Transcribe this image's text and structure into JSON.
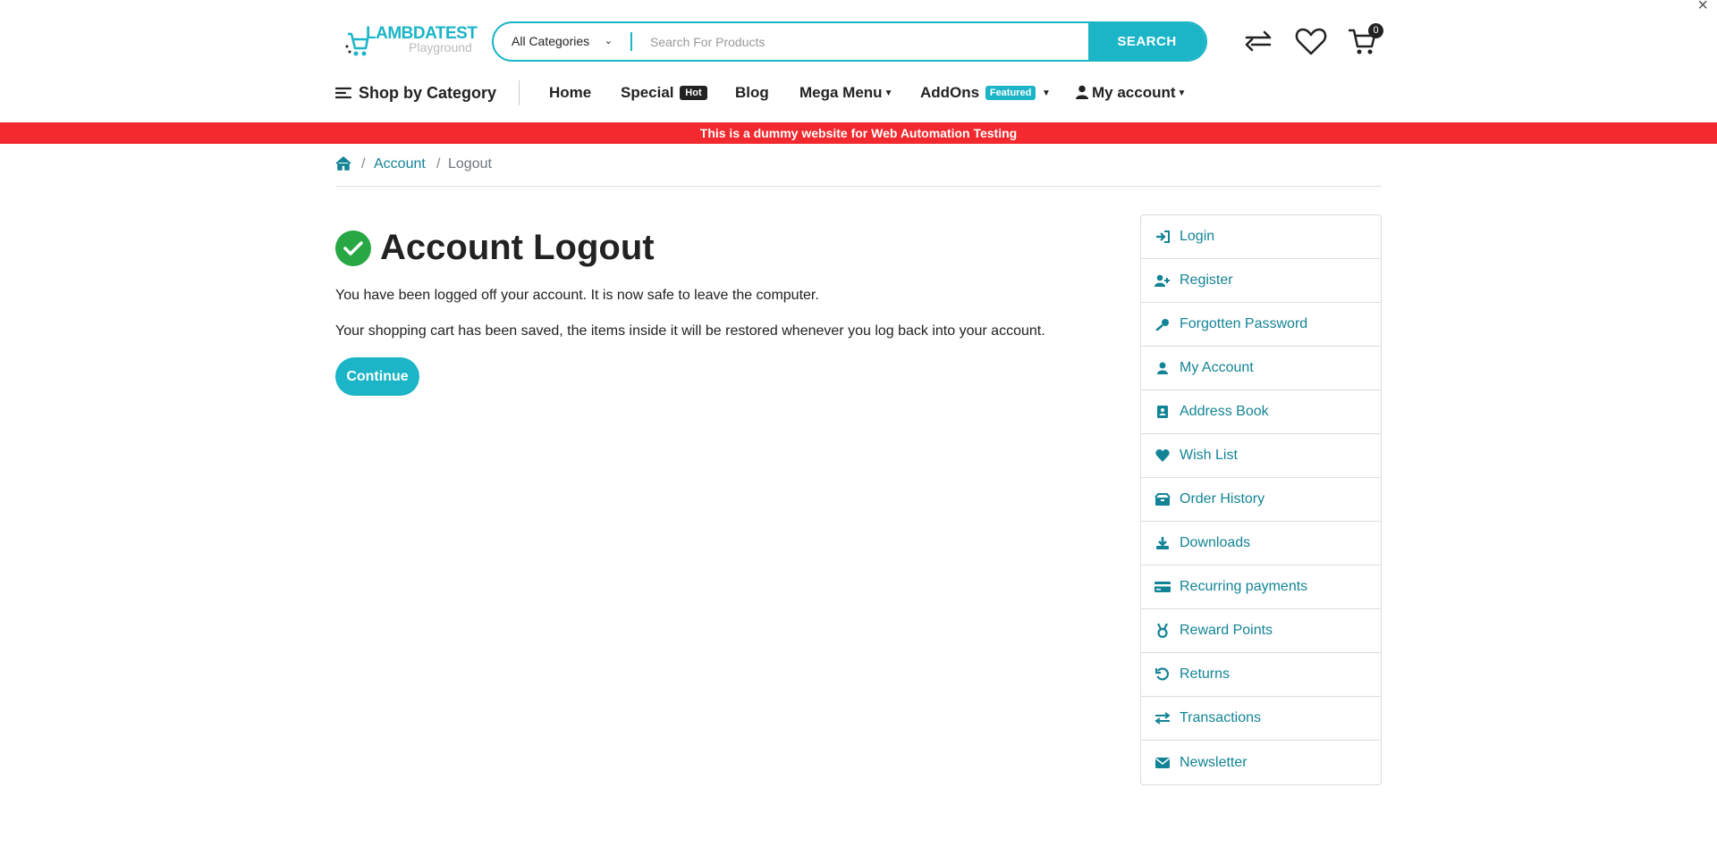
{
  "header": {
    "logo_brand": "LAMBDATEST",
    "logo_sub": "Playground",
    "category_select": "All Categories",
    "search_placeholder": "Search For Products",
    "search_button": "SEARCH",
    "cart_count": "0"
  },
  "nav": {
    "shop_by_category": "Shop by Category",
    "home": "Home",
    "special": "Special",
    "special_badge": "Hot",
    "blog": "Blog",
    "mega_menu": "Mega Menu",
    "addons": "AddOns",
    "addons_badge": "Featured",
    "my_account": "My account"
  },
  "banner": "This is a dummy website for Web Automation Testing",
  "breadcrumb": {
    "account": "Account",
    "current": "Logout",
    "separator": "/"
  },
  "main": {
    "title": "Account Logout",
    "message_1": "You have been logged off your account. It is now safe to leave the computer.",
    "message_2": "Your shopping cart has been saved, the items inside it will be restored whenever you log back into your account.",
    "continue_button": "Continue"
  },
  "sidebar": {
    "items": [
      {
        "label": "Login",
        "icon": "sign-in-icon"
      },
      {
        "label": "Register",
        "icon": "user-plus-icon"
      },
      {
        "label": "Forgotten Password",
        "icon": "key-icon"
      },
      {
        "label": "My Account",
        "icon": "user-icon"
      },
      {
        "label": "Address Book",
        "icon": "address-book-icon"
      },
      {
        "label": "Wish List",
        "icon": "heart-icon"
      },
      {
        "label": "Order History",
        "icon": "boxes-icon"
      },
      {
        "label": "Downloads",
        "icon": "download-icon"
      },
      {
        "label": "Recurring payments",
        "icon": "credit-card-icon"
      },
      {
        "label": "Reward Points",
        "icon": "medal-icon"
      },
      {
        "label": "Returns",
        "icon": "undo-icon"
      },
      {
        "label": "Transactions",
        "icon": "exchange-icon"
      },
      {
        "label": "Newsletter",
        "icon": "envelope-icon"
      }
    ]
  },
  "colors": {
    "accent": "#1bb5c7",
    "link": "#138496",
    "banner": "#f2292e",
    "success": "#28a745"
  }
}
